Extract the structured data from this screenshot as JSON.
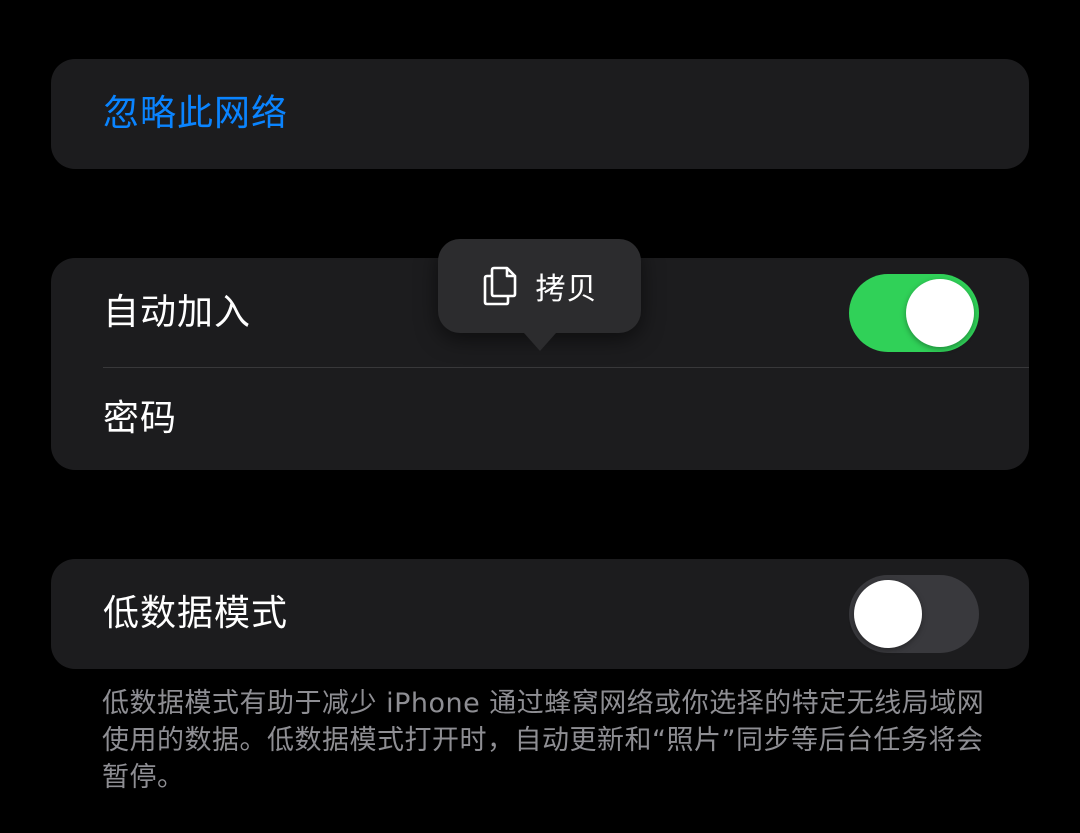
{
  "forget_network": {
    "label": "忽略此网络",
    "color": "#0a84ff"
  },
  "network_settings": {
    "auto_join": {
      "label": "自动加入",
      "toggle_on": true
    },
    "password": {
      "label": "密码"
    }
  },
  "low_data_mode": {
    "label": "低数据模式",
    "toggle_on": false,
    "description": "低数据模式有助于减少 iPhone 通过蜂窝网络或你选择的特定无线局域网使用的数据。低数据模式打开时，自动更新和“照片”同步等后台任务将会暂停。"
  },
  "context_menu": {
    "copy_label": "拷贝",
    "icon": "copy-icon"
  },
  "colors": {
    "toggle_on": "#30d158",
    "toggle_off": "#39393d",
    "card_background": "#1c1c1e"
  }
}
